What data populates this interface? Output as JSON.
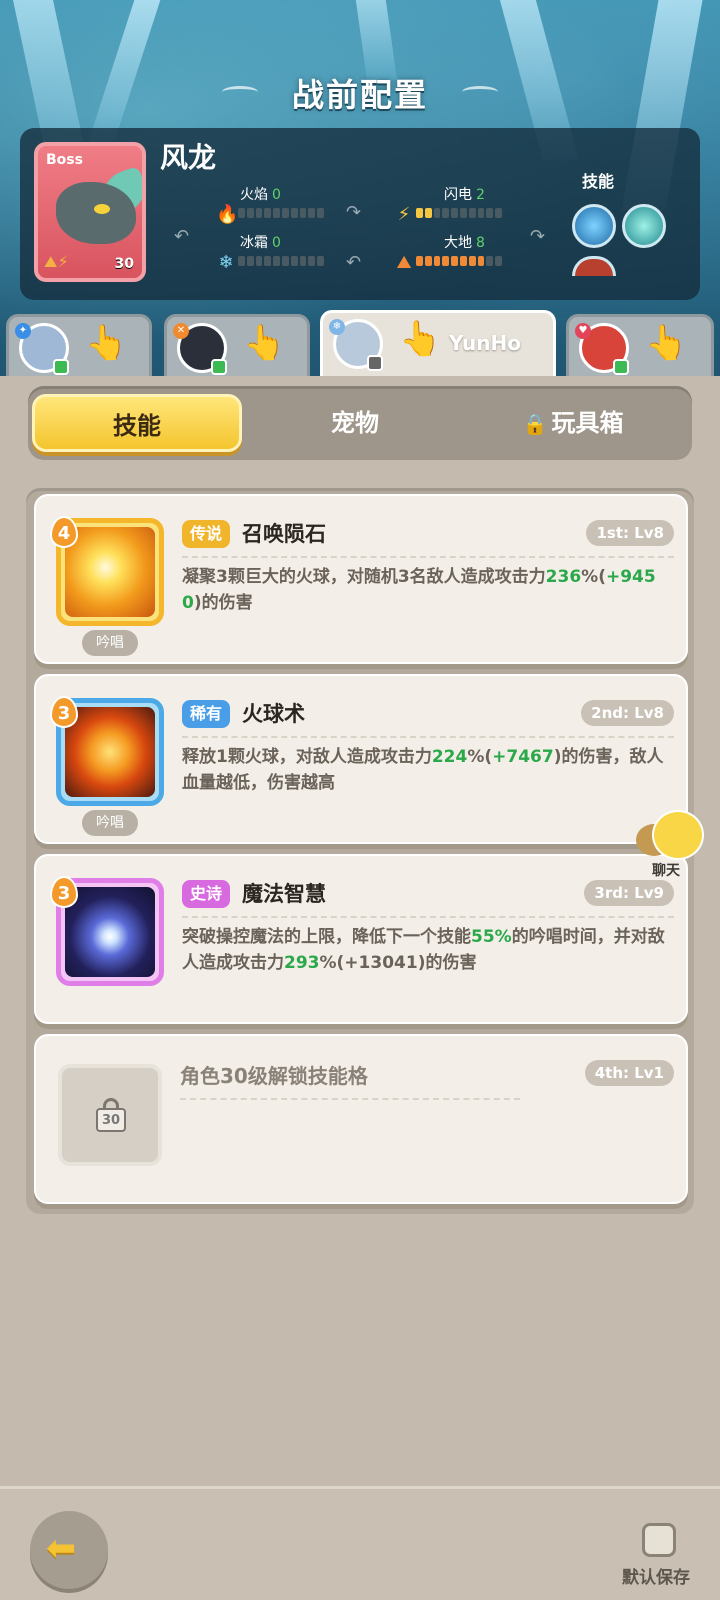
{
  "header": {
    "title": "战前配置"
  },
  "boss": {
    "tag": "Boss",
    "name": "风龙",
    "level": "30",
    "stats": [
      {
        "label": "火焰",
        "value": "0",
        "fill": 0,
        "icon": "fire-icon",
        "glyph": "🔥"
      },
      {
        "label": "闪电",
        "value": "2",
        "fill": 2,
        "icon": "lightning-icon",
        "glyph": "⚡"
      },
      {
        "label": "冰霜",
        "value": "0",
        "fill": 0,
        "icon": "snowflake-icon",
        "glyph": "❄"
      },
      {
        "label": "大地",
        "value": "8",
        "fill": 8,
        "icon": "earth-icon",
        "glyph": "⛰"
      }
    ],
    "skills_label": "技能"
  },
  "heroes": [
    {
      "name": "",
      "active": false,
      "avatar_color": "#9fb8d6",
      "badge_color": "#3a8ee6"
    },
    {
      "name": "",
      "active": false,
      "avatar_color": "#2b2f3a",
      "badge_color": "#f08a2e"
    },
    {
      "name": "YunHo",
      "active": true,
      "avatar_color": "#b9c9dc",
      "badge_color": "#7fb6e6"
    },
    {
      "name": "",
      "active": false,
      "avatar_color": "#d8443a",
      "badge_color": "#e2455a"
    }
  ],
  "tabs": {
    "skills": "技能",
    "pets": "宠物",
    "toybox": "玩具箱"
  },
  "cards": [
    {
      "cost": "4",
      "chant": "吟唱",
      "rarity": "传说",
      "rarity_color": "#f1b52c",
      "name": "召唤陨石",
      "slot": "1st: Lv8",
      "desc_before": "凝聚3颗巨大的火球，对随机3名敌人造成攻击力",
      "desc_hl1": "236",
      "desc_mid": "%(",
      "desc_hl2": "+9450",
      "desc_after": ")的伤害",
      "frame_color": "#f4b62a",
      "icon_name": "meteor-icon"
    },
    {
      "cost": "3",
      "chant": "吟唱",
      "rarity": "稀有",
      "rarity_color": "#4a9ee8",
      "name": "火球术",
      "slot": "2nd: Lv8",
      "desc_before": "释放1颗火球，对敌人造成攻击力",
      "desc_hl1": "224",
      "desc_mid": "%(",
      "desc_hl2": "+7467",
      "desc_after": ")的伤害，敌人血量越低，伤害越高",
      "frame_color": "#4aa9e6",
      "icon_name": "fireball-icon"
    },
    {
      "cost": "3",
      "chant": "",
      "rarity": "史诗",
      "rarity_color": "#d86ae0",
      "name": "魔法智慧",
      "slot": "3rd: Lv9",
      "desc_before": "突破操控魔法的上限，降低下一个技能",
      "desc_hl1": "55%",
      "desc_mid": "的吟唱时间，并对敌人造成攻击力",
      "desc_hl2": "293",
      "desc_after": "%(+13041)的伤害",
      "frame_color": "#e07ee8",
      "icon_name": "magic-star-icon"
    }
  ],
  "locked_card": {
    "text": "角色30级解锁技能格",
    "slot": "4th: Lv1",
    "lock_level": "30"
  },
  "chat": {
    "label": "聊天"
  },
  "footer": {
    "save_label": "默认保存"
  }
}
